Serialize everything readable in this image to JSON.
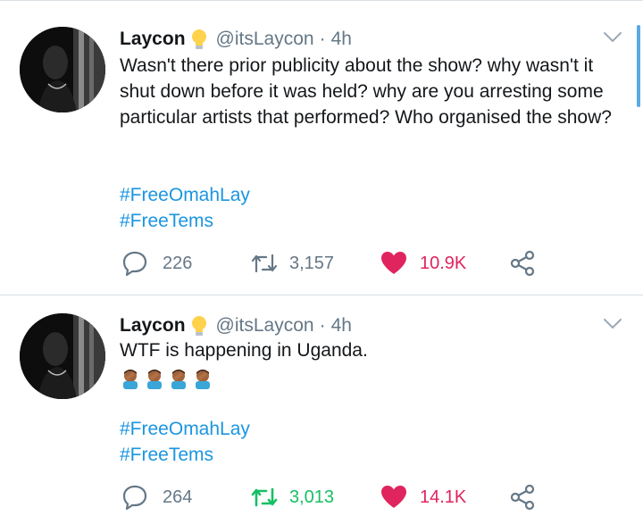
{
  "tweets": [
    {
      "name": "Laycon",
      "handle": "@itsLaycon",
      "separator": "·",
      "time": "4h",
      "text": "Wasn't there prior publicity about the show? why wasn't it shut down before it was held? why are you arresting some particular artists that performed? Who organised the show?",
      "emojis": [],
      "hashtags": [
        "#FreeOmahLay",
        "#FreeTems"
      ],
      "replies": "226",
      "retweets": "3,157",
      "likes": "10.9K",
      "retweeted": false,
      "liked": true
    },
    {
      "name": "Laycon",
      "handle": "@itsLaycon",
      "separator": "·",
      "time": "4h",
      "text": "WTF is happening in Uganda.",
      "emojis": [
        "person-facepalming-icon",
        "person-facepalming-icon",
        "person-facepalming-icon",
        "person-facepalming-icon"
      ],
      "hashtags": [
        "#FreeOmahLay",
        "#FreeTems"
      ],
      "replies": "264",
      "retweets": "3,013",
      "likes": "14.1K",
      "retweeted": true,
      "liked": true
    }
  ],
  "colors": {
    "link": "#1b95e0",
    "like": "#e0245e",
    "retweet_active": "#17bf63",
    "muted": "#657786",
    "scroll_accent": "#5aa9e6"
  }
}
